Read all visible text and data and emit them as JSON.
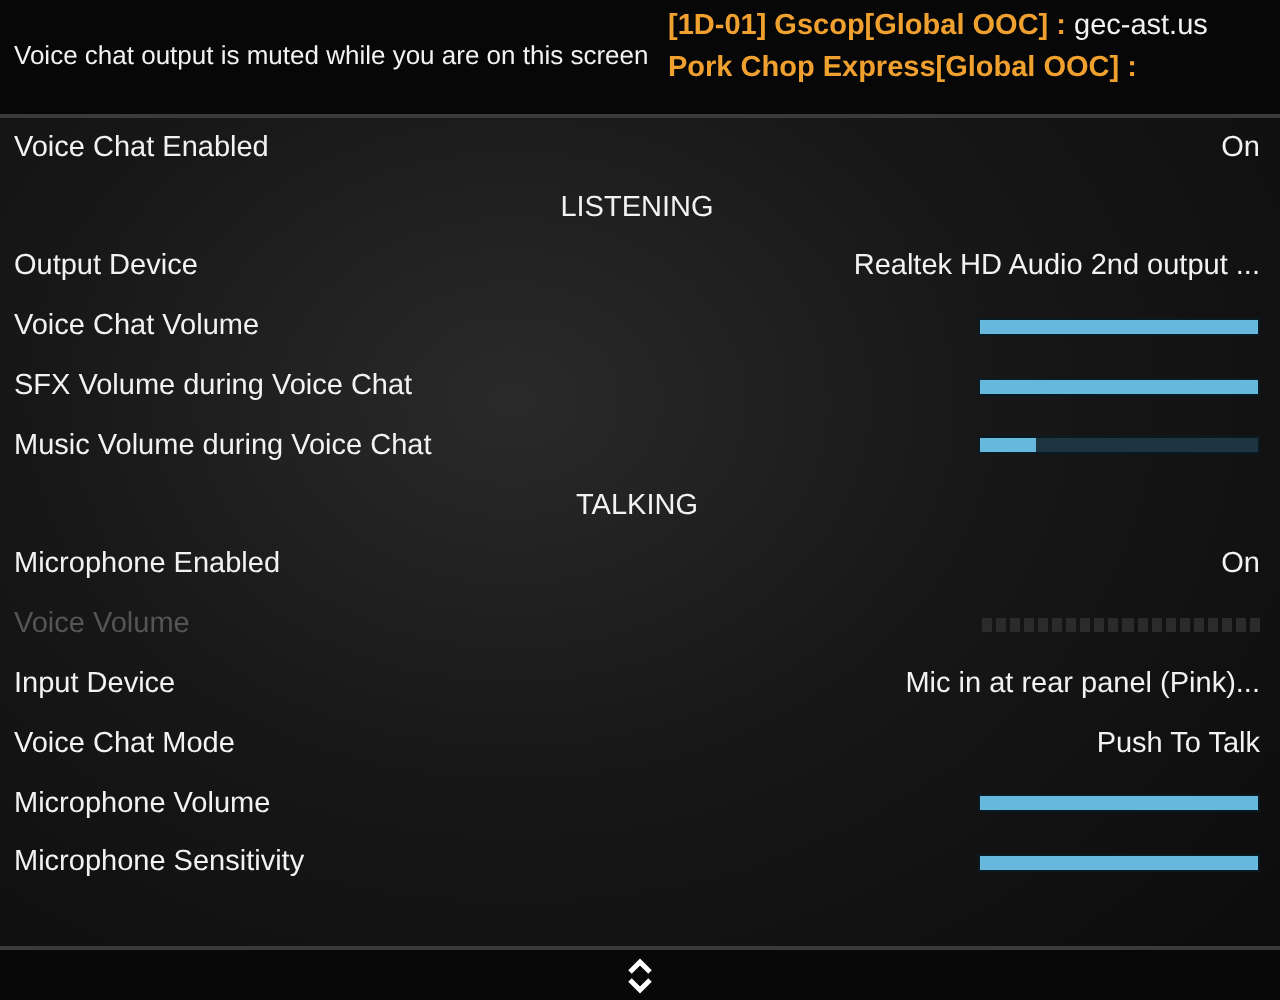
{
  "notice": "Voice chat output is muted while you are on this screen",
  "chat": [
    {
      "sender": "[1D-01] Gscop[Global OOC] :",
      "message": "gec-ast.us"
    },
    {
      "sender": "Pork Chop Express[Global OOC] :"
    }
  ],
  "settings": [
    {
      "kind": "value",
      "label": "Voice Chat Enabled",
      "value": "On",
      "disabled": false
    },
    {
      "kind": "header",
      "label": "LISTENING"
    },
    {
      "kind": "value",
      "label": "Output Device",
      "value": "Realtek HD Audio 2nd output ...",
      "disabled": false
    },
    {
      "kind": "slider",
      "label": "Voice Chat Volume",
      "level": 1,
      "disabled": false
    },
    {
      "kind": "slider",
      "label": "SFX Volume during Voice Chat",
      "level": 1,
      "disabled": false
    },
    {
      "kind": "slider",
      "label": "Music Volume during Voice Chat",
      "level": 0.2,
      "disabled": false
    },
    {
      "kind": "header",
      "label": "TALKING"
    },
    {
      "kind": "value",
      "label": "Microphone Enabled",
      "value": "On",
      "disabled": false
    },
    {
      "kind": "slider",
      "label": "Voice Volume",
      "disabled": true
    },
    {
      "kind": "value",
      "label": "Input Device",
      "value": "Mic in at rear panel (Pink)...",
      "disabled": false
    },
    {
      "kind": "value",
      "label": "Voice Chat Mode",
      "value": "Push To Talk",
      "disabled": false
    },
    {
      "kind": "slider",
      "label": "Microphone Volume",
      "level": 1,
      "disabled": false
    },
    {
      "kind": "slider",
      "label": "Microphone Sensitivity",
      "level": 1,
      "disabled": false
    }
  ]
}
